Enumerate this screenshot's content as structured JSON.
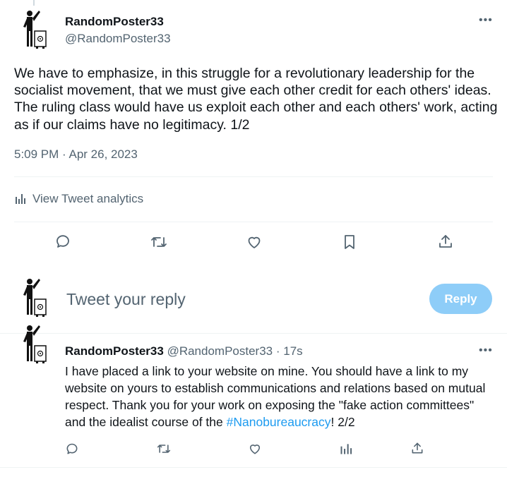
{
  "main_tweet": {
    "name": "RandomPoster33",
    "handle": "@RandomPoster33",
    "more": "•••",
    "text": "We have to emphasize, in this struggle for a revolutionary leadership for the socialist movement, that we must give each other credit for each others' ideas. The ruling class would have us exploit each other and each others' work, acting as if our claims have no legitimacy. 1/2",
    "timestamp": "5:09 PM · Apr 26, 2023",
    "analytics_label": "View Tweet analytics",
    "actions": [
      "reply-icon",
      "retweet-icon",
      "like-icon",
      "bookmark-icon",
      "share-icon"
    ]
  },
  "composer": {
    "placeholder": "Tweet your reply",
    "button_label": "Reply",
    "button_color": "#8ecdf8"
  },
  "reply_tweet": {
    "name": "RandomPoster33",
    "handle": "@RandomPoster33",
    "separator": " · ",
    "time": "17s",
    "more": "•••",
    "text_before": "I have placed a link to your website on mine. You should have a link to my website on yours to establish communications and relations based on mutual respect. Thank you for your work on exposing the \"fake action committees\" and the idealist course of the ",
    "hashtag": "#Nanobureaucracy",
    "text_after": "! 2/2",
    "actions": [
      "reply-icon",
      "retweet-icon",
      "like-icon",
      "analytics-icon",
      "share-icon"
    ]
  },
  "colors": {
    "text": "#0f1419",
    "secondary": "#536471",
    "link": "#1d9bf0",
    "divider": "#eff3f4"
  }
}
